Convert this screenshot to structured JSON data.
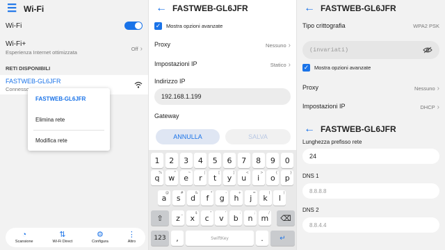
{
  "panel1": {
    "title": "Wi-Fi",
    "menu_icon": "hamburger-icon",
    "wifi_label": "Wi-Fi",
    "wifi_enabled": true,
    "wifiplus_label": "Wi-Fi+",
    "wifiplus_sub": "Esperienza Internet ottimizzata",
    "wifiplus_value": "Off",
    "section": "RETI DISPONIBILI",
    "network_name": "FASTWEB-GL6JFR",
    "network_status": "Connesso",
    "context_menu": {
      "title": "FASTWEB-GL6JFR",
      "delete": "Elimina rete",
      "modify": "Modifica rete"
    },
    "bottom": [
      {
        "icon": "scan-icon",
        "label": "Scansione"
      },
      {
        "icon": "wifi-direct-icon",
        "label": "Wi-Fi Direct"
      },
      {
        "icon": "gear-icon",
        "label": "Configura"
      },
      {
        "icon": "more-icon",
        "label": "Altro"
      }
    ]
  },
  "panel2": {
    "title": "FASTWEB-GL6JFR",
    "advanced_label": "Mostra opzioni avanzate",
    "proxy_label": "Proxy",
    "proxy_value": "Nessuno",
    "ip_settings_label": "Impostazioni IP",
    "ip_settings_value": "Statico",
    "ip_address_label": "Indirizzo IP",
    "ip_address_value": "192.168.1.199",
    "gateway_label": "Gateway",
    "cancel": "ANNULLA",
    "save": "SALVA",
    "keyboard": {
      "row1": [
        [
          "1",
          ""
        ],
        [
          "2",
          ""
        ],
        [
          "3",
          ""
        ],
        [
          "4",
          ""
        ],
        [
          "5",
          ""
        ],
        [
          "6",
          ""
        ],
        [
          "7",
          ""
        ],
        [
          "8",
          ""
        ],
        [
          "9",
          ""
        ],
        [
          "0",
          ""
        ]
      ],
      "row2": [
        [
          "q",
          "%"
        ],
        [
          "w",
          "^"
        ],
        [
          "e",
          "~"
        ],
        [
          "r",
          "|"
        ],
        [
          "t",
          "["
        ],
        [
          "y",
          "]"
        ],
        [
          "u",
          "<"
        ],
        [
          "i",
          ">"
        ],
        [
          "o",
          "{"
        ],
        [
          "p",
          "}"
        ]
      ],
      "row3": [
        [
          "a",
          "@"
        ],
        [
          "s",
          "#"
        ],
        [
          "d",
          "&"
        ],
        [
          "f",
          "*"
        ],
        [
          "g",
          "-"
        ],
        [
          "h",
          "+"
        ],
        [
          "j",
          "="
        ],
        [
          "k",
          "("
        ],
        [
          "l",
          ")"
        ]
      ],
      "row4": [
        [
          "z",
          "_"
        ],
        [
          "x",
          "$"
        ],
        [
          "c",
          "\""
        ],
        [
          "v",
          "'"
        ],
        [
          "b",
          ":"
        ],
        [
          "n",
          ";"
        ],
        [
          "m",
          "/"
        ]
      ],
      "row5_left": "123",
      "space_brand": "SwiftKey",
      "comma": ",",
      "period": "."
    }
  },
  "panel3": {
    "title": "FASTWEB-GL6JFR",
    "encryption_label": "Tipo crittografia",
    "encryption_value": "WPA2 PSK",
    "password_value": "(invariati)",
    "advanced_label": "Mostra opzioni avanzate",
    "proxy_label": "Proxy",
    "proxy_value": "Nessuno",
    "ip_settings_label": "Impostazioni IP",
    "ip_settings_value": "DHCP",
    "title2": "FASTWEB-GL6JFR",
    "prefix_label": "Lunghezza prefisso rete",
    "prefix_value": "24",
    "dns1_label": "DNS 1",
    "dns1_value": "8.8.8.8",
    "dns2_label": "DNS 2",
    "dns2_value": "8.8.4.4"
  }
}
